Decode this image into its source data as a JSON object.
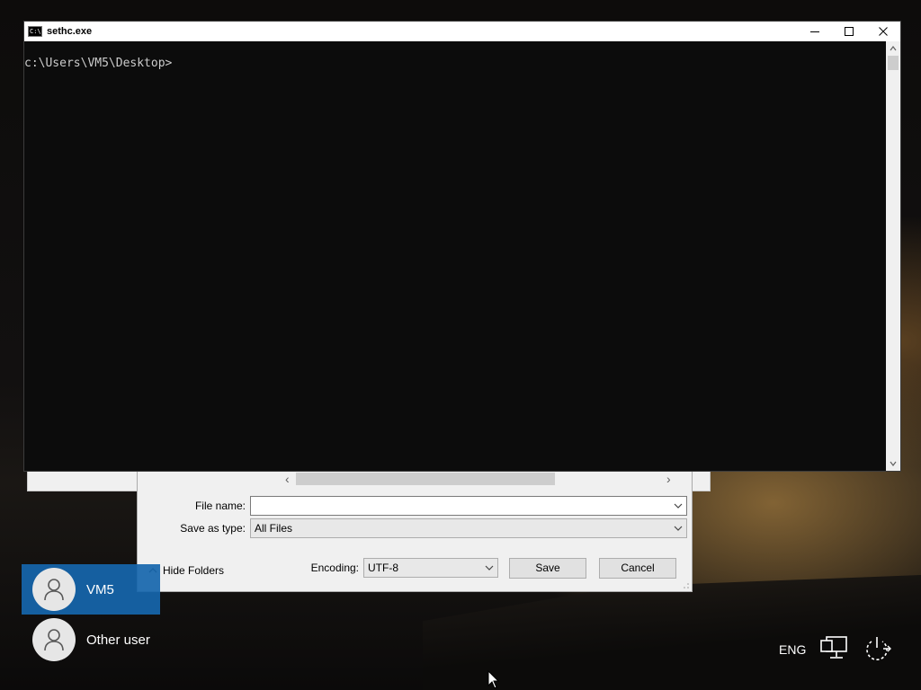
{
  "console": {
    "title": "sethc.exe",
    "icon_text": "C:\\",
    "prompt": "c:\\Users\\VM5\\Desktop>"
  },
  "save_dialog": {
    "file_name_label": "File name:",
    "file_name_value": "",
    "save_as_type_label": "Save as type:",
    "save_as_type_value": "All Files",
    "hide_folders_label": "Hide Folders",
    "encoding_label": "Encoding:",
    "encoding_value": "UTF-8",
    "save_label": "Save",
    "cancel_label": "Cancel"
  },
  "users": [
    {
      "name": "VM5",
      "selected": true
    },
    {
      "name": "Other user",
      "selected": false
    }
  ],
  "tray": {
    "language": "ENG",
    "icons": [
      "network-icon",
      "power-icon"
    ]
  },
  "colors": {
    "selected_user_bg": "#1666ac",
    "console_bg": "#0c0c0c",
    "console_text": "#cccccc"
  }
}
